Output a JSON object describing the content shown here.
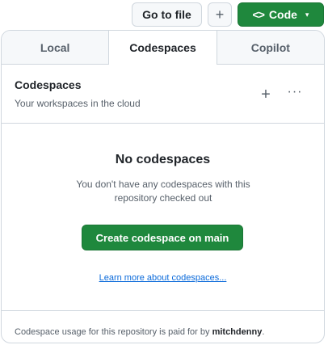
{
  "toolbar": {
    "goto_label": "Go to file",
    "add_label": "+",
    "code_icon": "<>",
    "code_label": "Code",
    "code_caret": "▾"
  },
  "tabs": [
    {
      "label": "Local",
      "active": false
    },
    {
      "label": "Codespaces",
      "active": true
    },
    {
      "label": "Copilot",
      "active": false
    }
  ],
  "header": {
    "title": "Codespaces",
    "subtitle": "Your workspaces in the cloud",
    "add_icon": "+",
    "more_icon": "···"
  },
  "empty_state": {
    "title": "No codespaces",
    "description": "You don't have any codespaces with this repository checked out",
    "create_button": "Create codespace on main",
    "learn_more": "Learn more about codespaces..."
  },
  "footer": {
    "text_prefix": "Codespace usage for this repository is paid for by ",
    "owner": "mitchdenny",
    "text_suffix": "."
  },
  "colors": {
    "accent_green": "#1f883d",
    "link_blue": "#0969da",
    "border": "#d0d7de"
  }
}
